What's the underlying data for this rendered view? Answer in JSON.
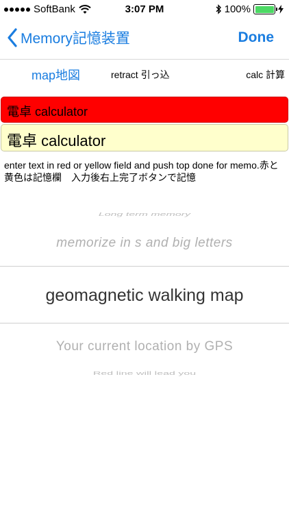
{
  "status_bar": {
    "carrier": "SoftBank",
    "time": "3:07 PM",
    "battery": "100%"
  },
  "nav": {
    "back_label": "Memory記憶装置",
    "done_label": "Done"
  },
  "toolbar": {
    "map_label": "map地図",
    "retract_label": "retract 引っ込",
    "calc_label": "calc 計算"
  },
  "fields": {
    "red_value": "電卓 calculator",
    "yellow_value": "電卓 calculator"
  },
  "instructions": "enter text in red or yellow field and push top done for memo.赤と黄色は記憶欄　入力後右上完了ボタンで記憶",
  "picker": {
    "top_far": "Long term memory",
    "top_near": "memorize in s and big letters",
    "selected": "geomagnetic walking map",
    "bottom_near": "Your current location by GPS",
    "bottom_far": "Red line will lead you"
  },
  "colors": {
    "accent": "#1a7de0",
    "red_field": "#ff0000",
    "yellow_field": "#ffffcc",
    "battery": "#4cd964"
  }
}
